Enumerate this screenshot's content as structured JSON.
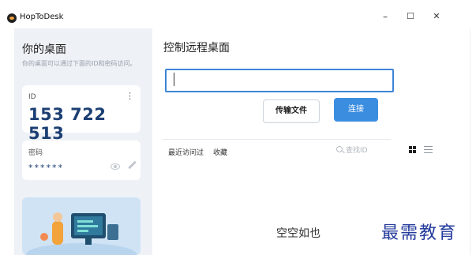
{
  "window": {
    "title": "HopToDesk",
    "minimize": "–",
    "maximize": "☐",
    "close": "✕"
  },
  "sidebar": {
    "title": "你的桌面",
    "description": "你的桌面可以通过下面的ID和密码访问。",
    "id_card": {
      "label": "ID",
      "menu": "⋮",
      "value": "153 722 513"
    },
    "password_card": {
      "label": "密码",
      "value": "******"
    }
  },
  "main": {
    "title": "控制远程桌面",
    "id_input": {
      "value": "",
      "placeholder": ""
    },
    "transfer_button": "传输文件",
    "connect_button": "连接",
    "tabs": [
      "最近访问过",
      "收藏"
    ],
    "search_placeholder": "查找ID",
    "empty_message": "空空如也"
  },
  "watermark": "最需教育",
  "colors": {
    "accent": "#3b8de0",
    "id_text": "#1c3f73",
    "sidebar_bg": "#eef1f6",
    "watermark": "#233a9c"
  }
}
